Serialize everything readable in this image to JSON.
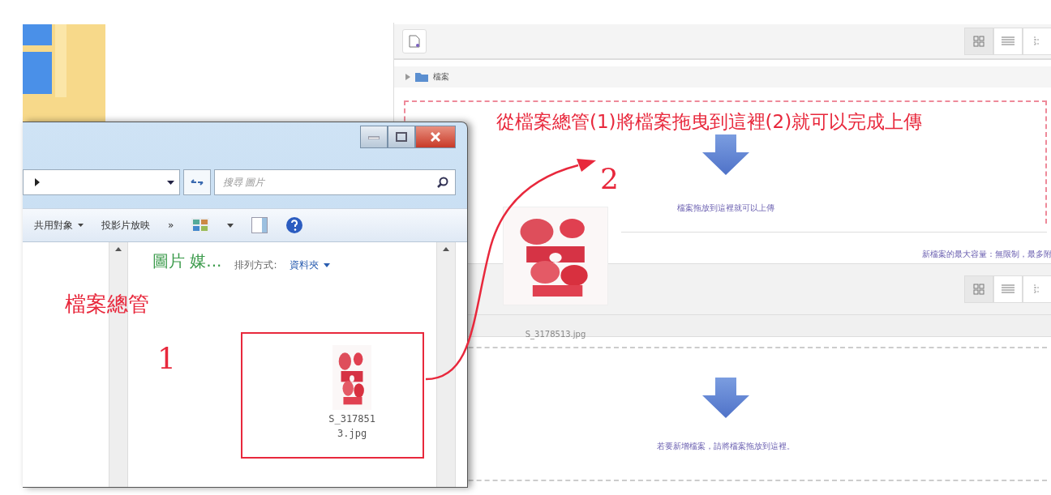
{
  "web_page": {
    "folder_path": "檔案",
    "drop_hint": "檔案拖放到這裡就可以上傳",
    "max_size_note": "新檔案的最大容量：無限制，最多附",
    "second_drop_hint": "若要新增檔案，請將檔案拖放到這裡。"
  },
  "drag_preview": {
    "file_name": "S_3178513.jpg"
  },
  "explorer": {
    "search": {
      "placeholder": "搜尋 圖片"
    },
    "toolbar": [
      {
        "label": "共用對象",
        "kind": "menu"
      },
      {
        "label": "投影片放映",
        "kind": "button"
      },
      {
        "label": "»",
        "kind": "more"
      }
    ],
    "library_title": "圖片 媒...",
    "sort_label": "排列方式:",
    "sort_value": "資料夾",
    "files": [
      {
        "name_lines": [
          "S_317851",
          "3.jpg"
        ]
      }
    ]
  },
  "annotations": {
    "headline": "從檔案總管(1)將檔案拖曳到這裡(2)就可以完成上傳",
    "explorer_label": "檔案總管",
    "step_1": "1",
    "step_2": "2"
  }
}
